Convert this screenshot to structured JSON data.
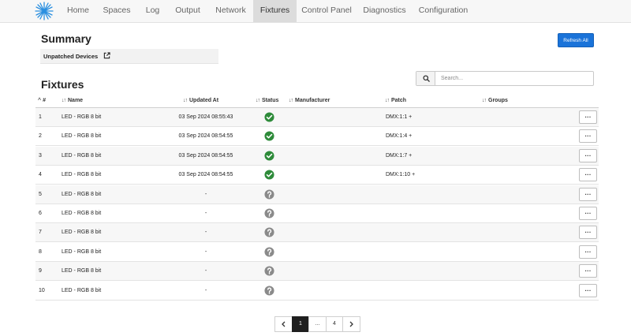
{
  "nav": {
    "items": [
      {
        "label": "Home"
      },
      {
        "label": "Spaces"
      },
      {
        "label": "Log"
      },
      {
        "label": "Output"
      },
      {
        "label": "Network"
      },
      {
        "label": "Fixtures"
      },
      {
        "label": "Control Panel"
      },
      {
        "label": "Diagnostics"
      },
      {
        "label": "Configuration"
      }
    ],
    "active": "Fixtures"
  },
  "summary": {
    "title": "Summary",
    "unpatched_label": "Unpatched Devices",
    "refresh_label": "Refresh All"
  },
  "fixtures": {
    "title": "Fixtures",
    "search_placeholder": "Search...",
    "columns": {
      "num": "#",
      "name": "Name",
      "updated": "Updated At",
      "status": "Status",
      "manufacturer": "Manufacturer",
      "patch": "Patch",
      "groups": "Groups"
    },
    "rows": [
      {
        "num": "1",
        "name": "LED - RGB 8 bit",
        "updated": "03 Sep 2024 08:55:43",
        "status": "ok",
        "manufacturer": "",
        "patch": "DMX:1:1 +",
        "groups": ""
      },
      {
        "num": "2",
        "name": "LED - RGB 8 bit",
        "updated": "03 Sep 2024 08:54:55",
        "status": "ok",
        "manufacturer": "",
        "patch": "DMX:1:4 +",
        "groups": ""
      },
      {
        "num": "3",
        "name": "LED - RGB 8 bit",
        "updated": "03 Sep 2024 08:54:55",
        "status": "ok",
        "manufacturer": "",
        "patch": "DMX:1:7 +",
        "groups": ""
      },
      {
        "num": "4",
        "name": "LED - RGB 8 bit",
        "updated": "03 Sep 2024 08:54:55",
        "status": "ok",
        "manufacturer": "",
        "patch": "DMX:1:10 +",
        "groups": ""
      },
      {
        "num": "5",
        "name": "LED - RGB 8 bit",
        "updated": "-",
        "status": "unknown",
        "manufacturer": "",
        "patch": "",
        "groups": ""
      },
      {
        "num": "6",
        "name": "LED - RGB 8 bit",
        "updated": "-",
        "status": "unknown",
        "manufacturer": "",
        "patch": "",
        "groups": ""
      },
      {
        "num": "7",
        "name": "LED - RGB 8 bit",
        "updated": "-",
        "status": "unknown",
        "manufacturer": "",
        "patch": "",
        "groups": ""
      },
      {
        "num": "8",
        "name": "LED - RGB 8 bit",
        "updated": "-",
        "status": "unknown",
        "manufacturer": "",
        "patch": "",
        "groups": ""
      },
      {
        "num": "9",
        "name": "LED - RGB 8 bit",
        "updated": "-",
        "status": "unknown",
        "manufacturer": "",
        "patch": "",
        "groups": ""
      },
      {
        "num": "10",
        "name": "LED - RGB 8 bit",
        "updated": "-",
        "status": "unknown",
        "manufacturer": "",
        "patch": "",
        "groups": ""
      }
    ],
    "row_menu_label": "···"
  },
  "pagination": {
    "prev_icon": "chevron-left-icon",
    "pages": [
      "1",
      "...",
      "4"
    ],
    "current": "1",
    "next_icon": "chevron-right-icon"
  },
  "colors": {
    "accent": "#1a73d9",
    "status_ok": "#2e8b3a",
    "status_unknown": "#8a8a8a",
    "pager_active": "#1f1f1f"
  },
  "icons": {
    "logo": "starburst-logo-icon",
    "external_link": "external-link-icon",
    "search": "search-icon",
    "status_ok": "check-circle-icon",
    "status_unknown": "question-circle-icon",
    "sort": "sort-arrows-icon",
    "sort_active": "sort-up-icon"
  }
}
